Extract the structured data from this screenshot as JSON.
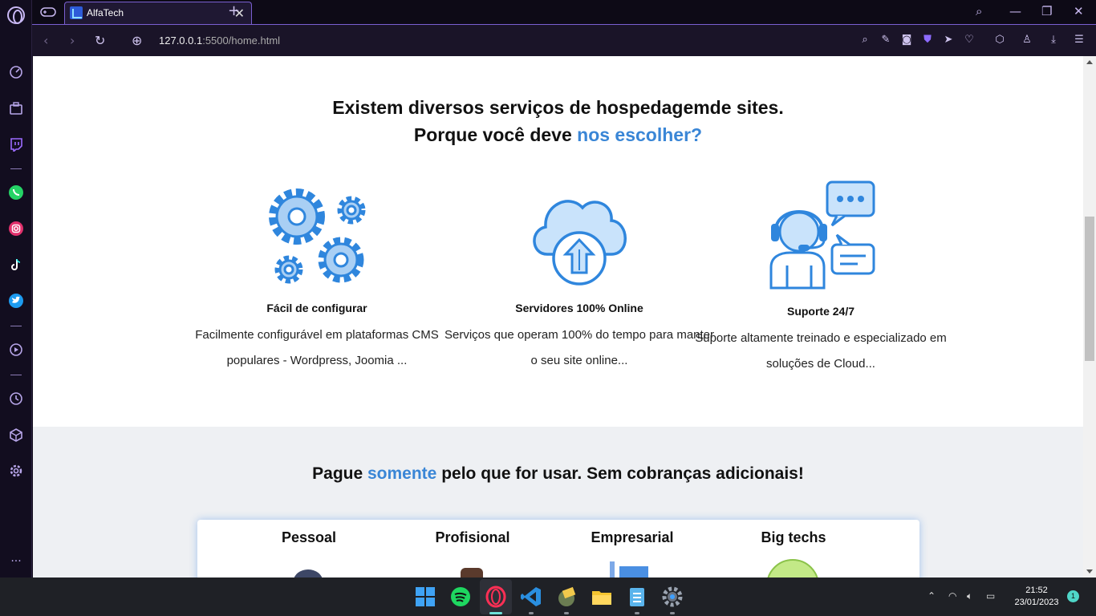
{
  "browser": {
    "tab_title": "AlfaTech",
    "url_host": "127.0.0.1",
    "url_rest": ":5500/home.html"
  },
  "hero": {
    "line1": "Existem diversos serviços de hospedagemde sites.",
    "line2_plain": "Porque você deve ",
    "line2_accent": "nos escolher?"
  },
  "features": [
    {
      "icon": "gears-icon",
      "title": "Fácil de configurar",
      "desc": "Facilmente configurável em plataformas CMS populares - Wordpress, Joomia ..."
    },
    {
      "icon": "cloud-upload-icon",
      "title": "Servidores 100% Online",
      "desc": "Serviços que operam 100% do tempo para manter o seu site online..."
    },
    {
      "icon": "support-agent-icon",
      "title": "Suporte 24/7",
      "desc": "Suporte altamente treinado e especializado em soluções de Cloud..."
    }
  ],
  "pricing": {
    "title_start": "Pague ",
    "title_accent": "somente",
    "title_end": " pelo que for usar. Sem cobranças adicionais!",
    "plans": [
      "Pessoal",
      "Profisional",
      "Empresarial",
      "Big techs"
    ]
  },
  "taskbar": {
    "time": "21:52",
    "date": "23/01/2023",
    "notification_count": "1"
  },
  "colors": {
    "accent": "#3a86d6",
    "browser_accent": "#7a5fd1"
  }
}
